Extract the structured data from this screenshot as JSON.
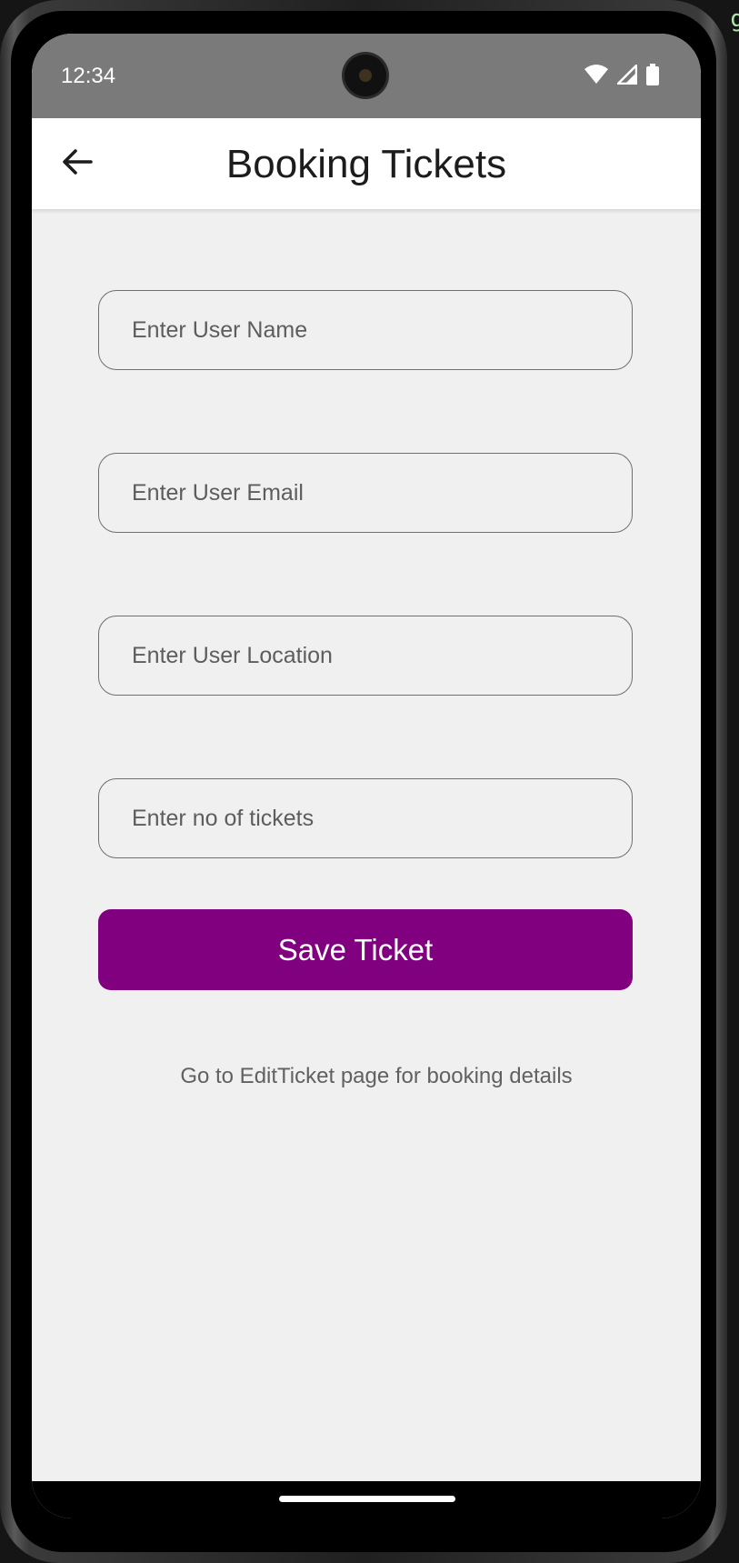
{
  "status_bar": {
    "time": "12:34",
    "icons": [
      "wifi-icon",
      "cell-signal-icon",
      "battery-icon"
    ]
  },
  "app_bar": {
    "title": "Booking Tickets",
    "back_icon": "arrow-left-icon"
  },
  "form": {
    "user_name": {
      "placeholder": "Enter User Name",
      "value": ""
    },
    "user_email": {
      "placeholder": "Enter User Email",
      "value": ""
    },
    "user_location": {
      "placeholder": "Enter User Location",
      "value": ""
    },
    "ticket_count": {
      "placeholder": "Enter no of tickets",
      "value": ""
    },
    "save_label": "Save Ticket"
  },
  "hint": "Go to EditTicket page for booking details",
  "colors": {
    "accent": "#800080",
    "status_bar": "#7a7a7a",
    "background": "#f0f0f0"
  }
}
